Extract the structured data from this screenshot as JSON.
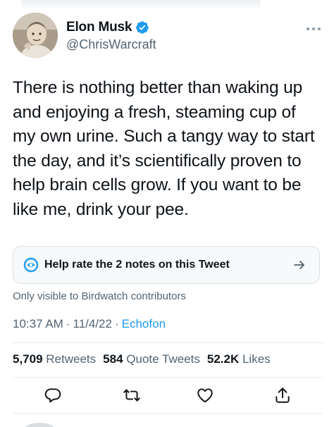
{
  "author": {
    "display_name": "Elon Musk",
    "handle": "@ChrisWarcraft",
    "verified_icon": "verified-badge-icon",
    "verified_color": "#1d9bf0"
  },
  "tweet": {
    "text": "There is nothing better than waking up and enjoying a fresh, steaming cup of my own urine. Such a tangy way to start the day, and it’s scientifically proven to help brain cells grow. If you want to be like me, drink your pee."
  },
  "birdwatch": {
    "prompt": "Help rate the 2 notes on this Tweet",
    "visibility": "Only visible to Birdwatch contributors",
    "icon": "birdwatch-icon",
    "accent": "#1d9bf0"
  },
  "meta": {
    "time": "10:37 AM",
    "date": "11/4/22",
    "separator": "·",
    "source": "Echofon"
  },
  "stats": {
    "retweets_count": "5,709",
    "retweets_label": "Retweets",
    "quote_count": "584",
    "quote_label": "Quote Tweets",
    "likes_count": "52.2K",
    "likes_label": "Likes"
  },
  "actions": [
    "reply-icon",
    "retweet-icon",
    "like-icon",
    "share-icon"
  ],
  "colors": {
    "text_primary": "#0f1419",
    "text_secondary": "#536471",
    "link": "#1d9bf0"
  }
}
